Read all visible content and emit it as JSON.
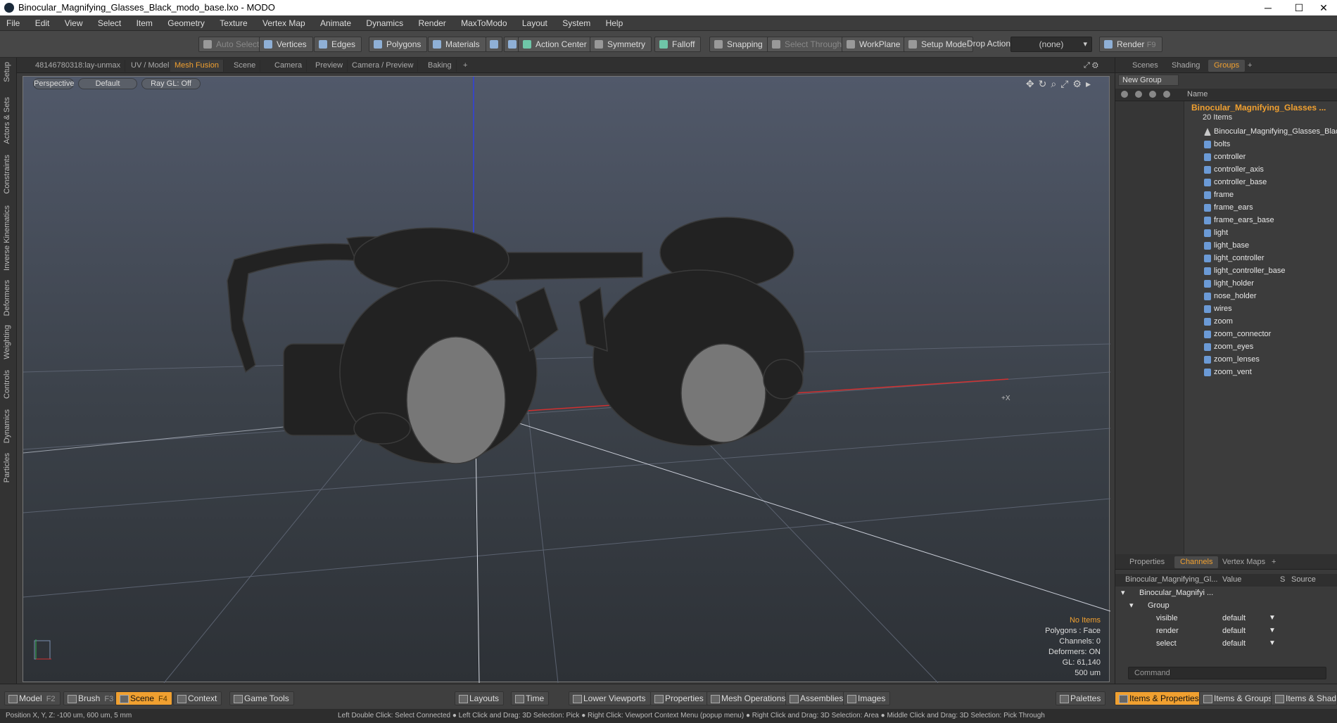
{
  "window": {
    "title": "Binocular_Magnifying_Glasses_Black_modo_base.lxo - MODO",
    "minimize": "─",
    "maximize": "☐",
    "close": "✕"
  },
  "menu": [
    "File",
    "Edit",
    "View",
    "Select",
    "Item",
    "Geometry",
    "Texture",
    "Vertex Map",
    "Animate",
    "Dynamics",
    "Render",
    "MaxToModo",
    "Layout",
    "System",
    "Help"
  ],
  "toolbar": {
    "auto_select": "Auto Select",
    "vertices": "Vertices",
    "edges": "Edges",
    "polygons": "Polygons",
    "materials": "Materials",
    "action_center": "Action Center",
    "symmetry": "Symmetry",
    "falloff": "Falloff",
    "snapping": "Snapping",
    "select_through": "Select Through",
    "workplane": "WorkPlane",
    "setup_mode": "Setup Mode",
    "drop_action": "Drop Action",
    "drop_action_value": "(none)",
    "render": "Render",
    "render_key": "F9"
  },
  "left_tabs": [
    "Setup",
    "Actors & Sets",
    "Constraints",
    "Inverse Kinematics",
    "Deformers",
    "Weighting",
    "Controls",
    "Dynamics",
    "Particles"
  ],
  "viewport_tabs": [
    "48146780318:lay-unmax",
    "UV / Model",
    "Mesh Fusion",
    "Scene",
    "Camera",
    "Preview",
    "Camera / Preview",
    "Baking",
    "+"
  ],
  "viewport": {
    "view": "Perspective",
    "shading": "Default",
    "raygl": "Ray GL: Off",
    "axis_label": "+X",
    "hud": {
      "items": "No Items",
      "polygons": "Polygons : Face",
      "channels": "Channels: 0",
      "deformers": "Deformers: ON",
      "gl": "GL: 61,140",
      "scale": "500 um"
    }
  },
  "right_tabs": [
    "Scenes",
    "Shading",
    "Groups",
    "+"
  ],
  "groups": {
    "new_group": "New Group",
    "name_header": "Name",
    "group_name": "Binocular_Magnifying_Glasses ...",
    "group_count": "20 Items",
    "items": [
      "Binocular_Magnifying_Glasses_Black",
      "bolts",
      "controller",
      "controller_axis",
      "controller_base",
      "frame",
      "frame_ears",
      "frame_ears_base",
      "light",
      "light_base",
      "light_controller",
      "light_controller_base",
      "light_holder",
      "nose_holder",
      "wires",
      "zoom",
      "zoom_connector",
      "zoom_eyes",
      "zoom_lenses",
      "zoom_vent"
    ]
  },
  "lower_tabs": [
    "Properties",
    "Channels",
    "Vertex Maps",
    "+"
  ],
  "channels": {
    "col_name": "Binocular_Magnifying_Gl...",
    "col_value": "Value",
    "col_s": "S",
    "col_source": "Source",
    "root": "Binocular_Magnifyi ...",
    "group": "Group",
    "rows": [
      {
        "name": "visible",
        "value": "default"
      },
      {
        "name": "render",
        "value": "default"
      },
      {
        "name": "select",
        "value": "default"
      }
    ]
  },
  "command_placeholder": "Command",
  "bottom": {
    "model": "Model",
    "model_key": "F2",
    "brush": "Brush",
    "brush_key": "F3",
    "scene": "Scene",
    "scene_key": "F4",
    "context": "Context",
    "game_tools": "Game Tools",
    "layouts": "Layouts",
    "time": "Time",
    "lower_viewports": "Lower Viewports",
    "properties": "Properties",
    "mesh_operations": "Mesh Operations",
    "assemblies": "Assemblies",
    "images": "Images",
    "palettes": "Palettes",
    "items_properties": "Items & Properties",
    "items_groups": "Items & Groups",
    "items_shading": "Items & Shadin"
  },
  "status": {
    "position": "Position X, Y, Z:  -100 um, 600 um, 5 mm",
    "hints": "Left Double Click: Select Connected ● Left Click and Drag: 3D Selection: Pick ● Right Click: Viewport Context Menu (popup menu) ● Right Click and Drag: 3D Selection: Area ● Middle Click and Drag: 3D Selection: Pick Through"
  },
  "colors": {
    "accent": "#f0a030",
    "axis_x": "#d03030",
    "axis_y": "#30b050",
    "axis_z": "#3040e0"
  }
}
